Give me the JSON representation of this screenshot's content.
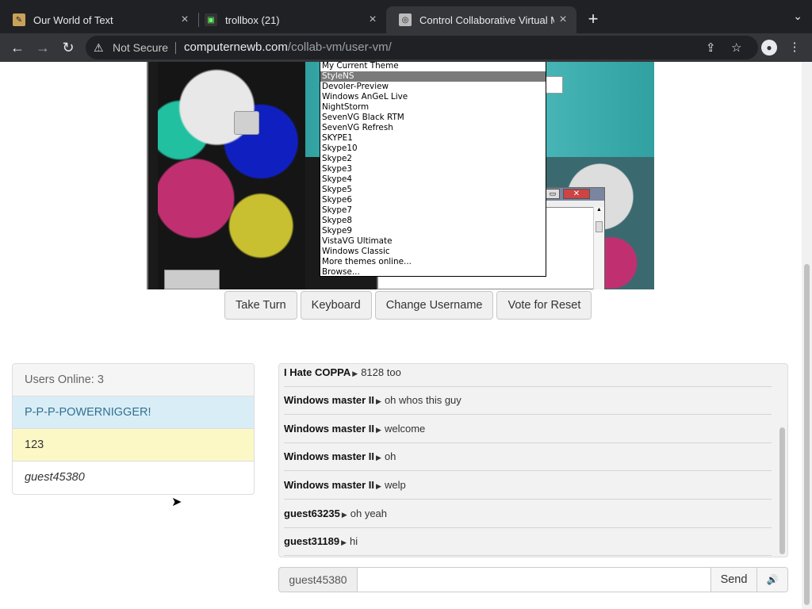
{
  "browser": {
    "tabs": [
      {
        "title": "Our World of Text",
        "close": "×"
      },
      {
        "title": "trollbox (21)",
        "close": "×"
      },
      {
        "title": "Control Collaborative Virtual M",
        "close": "×"
      }
    ],
    "new_tab": "+",
    "tab_menu": "⌄",
    "nav": {
      "back": "←",
      "forward": "→",
      "reload": "↻"
    },
    "security": "Not Secure",
    "url_host": "computernewb.com",
    "url_path": "/collab-vm/user-vm/"
  },
  "vm": {
    "dropdown_options": [
      "My Current Theme",
      "StyleNS",
      "Devoler-Preview",
      "Windows AnGeL Live",
      "NightStorm",
      "SevenVG Black RTM",
      "SevenVG Refresh",
      "SKYPE1",
      "Skype10",
      "Skype2",
      "Skype3",
      "Skype4",
      "Skype5",
      "Skype6",
      "Skype7",
      "Skype8",
      "Skype9",
      "VistaVG Ultimate",
      "Windows Classic",
      "More themes online...",
      "Browse..."
    ],
    "selected_option": "StyleNS"
  },
  "controls": {
    "take_turn": "Take Turn",
    "keyboard": "Keyboard",
    "change_username": "Change Username",
    "vote_reset": "Vote for Reset"
  },
  "users": {
    "header": "Users Online: 3",
    "list": [
      "P-P-P-POWERNIGGER!",
      "123",
      "guest45380"
    ]
  },
  "chat": {
    "messages": [
      {
        "user": "I Hate COPPA",
        "text": "8128 too"
      },
      {
        "user": "Windows master II",
        "text": "oh whos this guy"
      },
      {
        "user": "Windows master II",
        "text": "welcome"
      },
      {
        "user": "Windows master II",
        "text": "oh"
      },
      {
        "user": "Windows master II",
        "text": "welp"
      },
      {
        "user": "guest63235",
        "text": "oh yeah"
      },
      {
        "user": "guest31189",
        "text": "hi"
      }
    ],
    "username": "guest45380",
    "input_value": "",
    "send": "Send"
  }
}
